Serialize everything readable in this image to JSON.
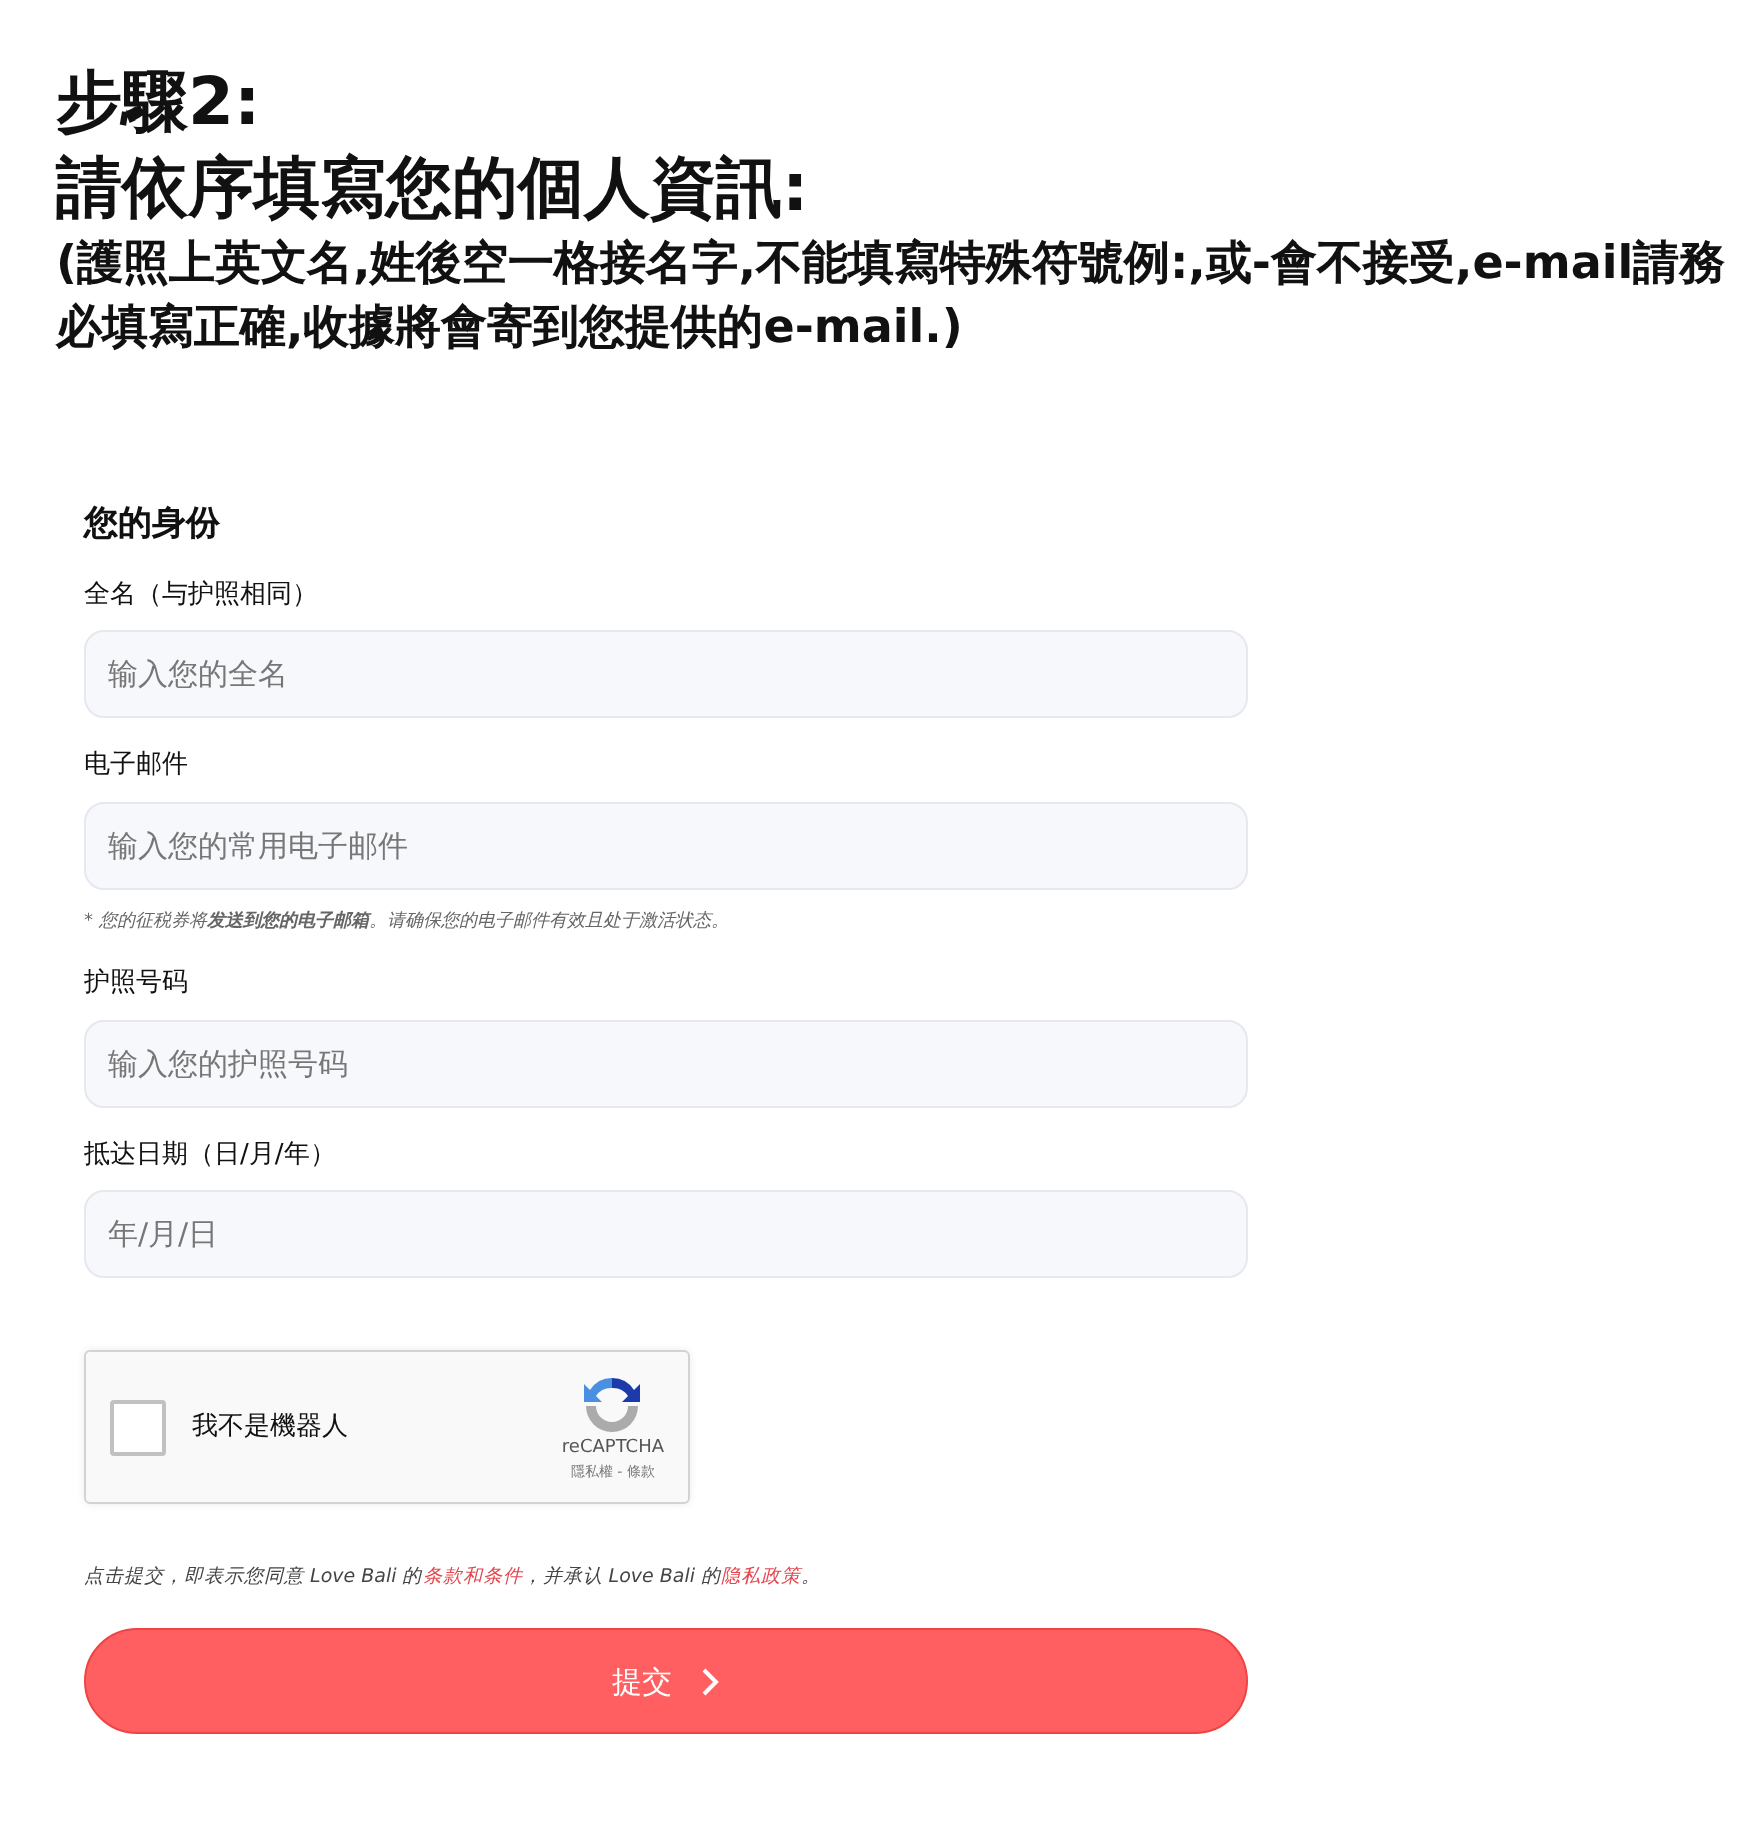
{
  "heading": {
    "step": "步驟2:",
    "title": "請依序填寫您的個人資訊:",
    "note": "(護照上英文名,姓後空一格接名字,不能填寫特殊符號例:,或-會不接受,e-mail請務必填寫正確,收據將會寄到您提供的e-mail.)"
  },
  "form": {
    "section_title": "您的身份",
    "fields": [
      {
        "label": "全名（与护照相同）",
        "placeholder": "输入您的全名"
      },
      {
        "label": "电子邮件",
        "placeholder": "输入您的常用电子邮件",
        "hint": "* 您的征税券将**发送到您的电子邮箱**。请确保您的电子邮件有效且处于激活状态。"
      },
      {
        "label": "护照号码",
        "placeholder": "输入您的护照号码"
      },
      {
        "label": "抵达日期（日/月/年）",
        "placeholder": "年/月/日"
      }
    ],
    "captcha": {
      "checked": false,
      "label": "我不是機器人",
      "brand": "reCAPTCHA",
      "links": "隱私權 - 條款"
    },
    "terms": {
      "before": "点击提交，即表示您同意 Love Bali 的",
      "terms_link": "条款和条件",
      "middle": "，并承认 Love Bali 的",
      "privacy_link": "隐私政策",
      "after": "。"
    },
    "submit": "提交"
  }
}
